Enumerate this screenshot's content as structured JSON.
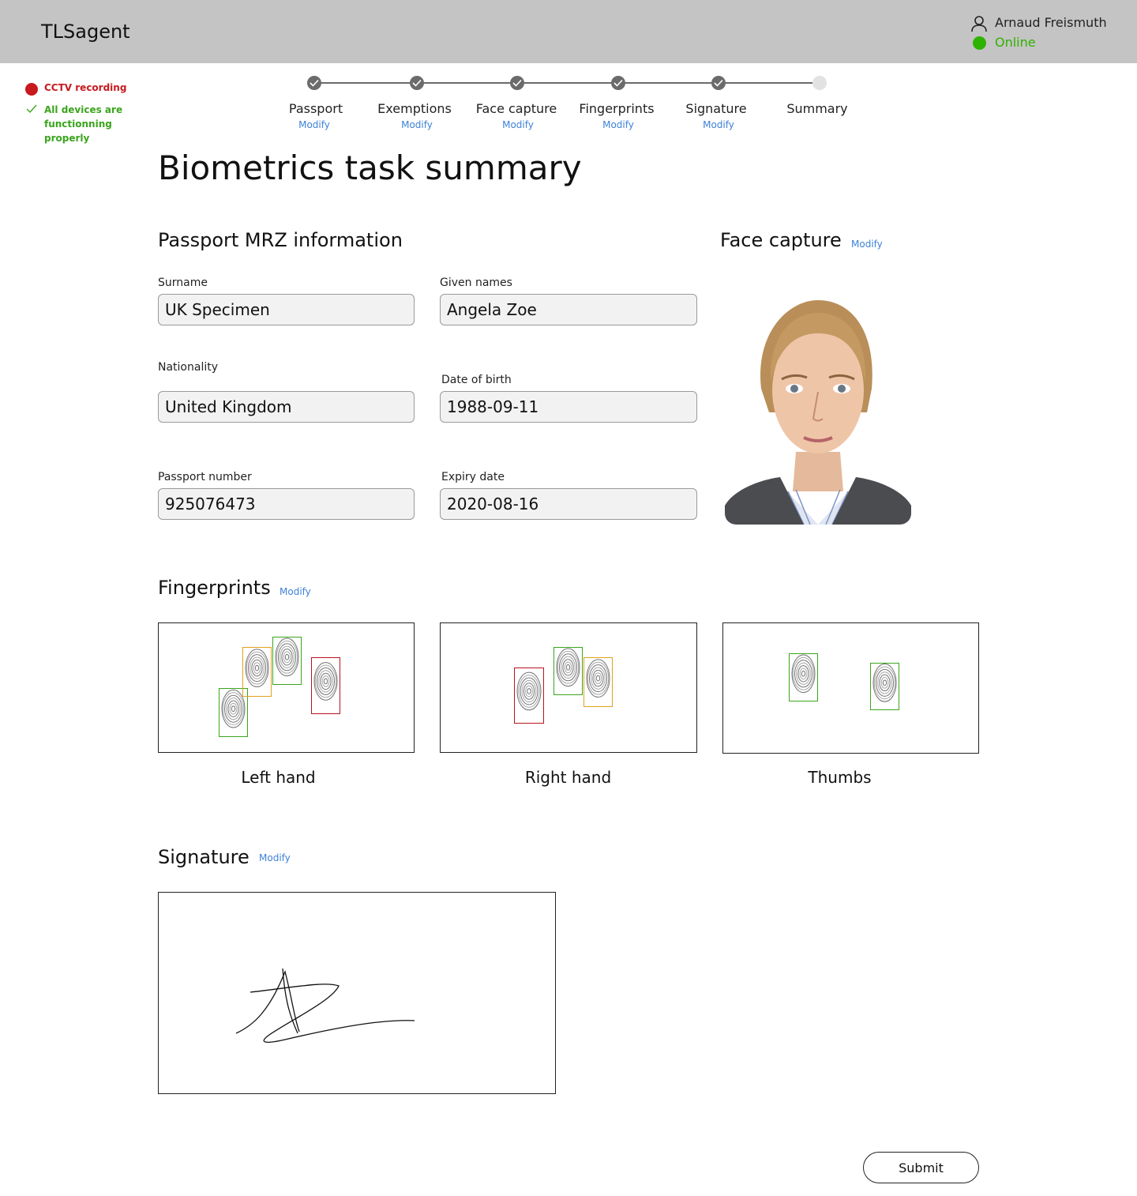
{
  "header": {
    "app_title": "TLSagent",
    "user_name": "Arnaud Freismuth",
    "status": "Online",
    "status_color": "#2fb300"
  },
  "side_status": {
    "cctv_label": "CCTV recording",
    "cctv_color": "#c8191e",
    "devices_label": "All devices are functionning properly",
    "devices_color": "#3aa51c"
  },
  "stepper": {
    "modify_color": "#3e82d6",
    "steps": [
      {
        "label": "Passport",
        "modify": "Modify",
        "state": "done"
      },
      {
        "label": "Exemptions",
        "modify": "Modify",
        "state": "done"
      },
      {
        "label": "Face capture",
        "modify": "Modify",
        "state": "done"
      },
      {
        "label": "Fingerprints",
        "modify": "Modify",
        "state": "done"
      },
      {
        "label": "Signature",
        "modify": "Modify",
        "state": "done"
      },
      {
        "label": "Summary",
        "modify": "",
        "state": "current"
      }
    ]
  },
  "page_title": "Biometrics task summary",
  "passport": {
    "title": "Passport MRZ information",
    "surname_label": "Surname",
    "surname_value": "UK Specimen",
    "given_names_label": "Given names",
    "given_names_value": "Angela Zoe",
    "nationality_label": "Nationality",
    "nationality_value": "United Kingdom",
    "dob_label": "Date of birth",
    "dob_value": "1988-09-11",
    "passport_number_label": "Passport number",
    "passport_number_value": "925076473",
    "expiry_label": "Expiry date",
    "expiry_value": "2020-08-16"
  },
  "face_capture": {
    "title": "Face capture",
    "modify": "Modify"
  },
  "fingerprints": {
    "title": "Fingerprints",
    "modify": "Modify",
    "quality_colors": {
      "good": "#3aa51c",
      "medium": "#e0a21c",
      "poor": "#b5141e"
    },
    "left_hand_caption": "Left hand",
    "right_hand_caption": "Right hand",
    "thumbs_caption": "Thumbs"
  },
  "signature": {
    "title": "Signature",
    "modify": "Modify"
  },
  "actions": {
    "submit_label": "Submit"
  }
}
